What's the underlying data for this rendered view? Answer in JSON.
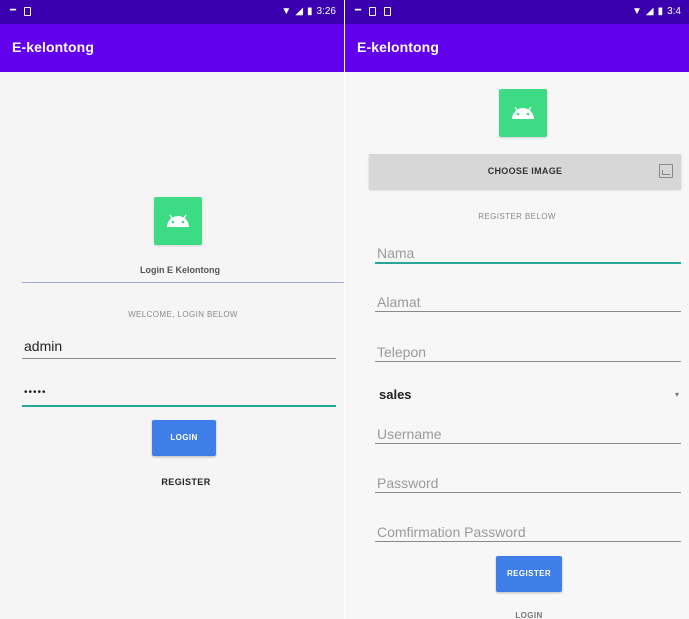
{
  "left": {
    "status": {
      "time": "3:26"
    },
    "app_title": "E-kelontong",
    "logo_caption": "Login E Kelontong",
    "welcome": "WELCOME, LOGIN BELOW",
    "username_value": "admin",
    "password_value": "•••••",
    "login_button": "LOGIN",
    "register_link": "REGISTER"
  },
  "right": {
    "status": {
      "time": "3:4"
    },
    "app_title": "E-kelontong",
    "choose_image": "CHOOSE IMAGE",
    "register_below": "REGISTER BELOW",
    "fields": {
      "nama": "Nama",
      "alamat": "Alamat",
      "telepon": "Telepon",
      "role_value": "sales",
      "username": "Username",
      "password": "Password",
      "confirm": "Comfirmation Password"
    },
    "register_button": "REGISTER",
    "login_link": "LOGIN"
  },
  "colors": {
    "statusbar": "#3a00b0",
    "appbar": "#6200ee",
    "accent": "#26a69a",
    "button": "#3f7ee8",
    "android_logo": "#3ddc84"
  },
  "icons": [
    "wifi-icon",
    "signal-icon",
    "battery-icon",
    "android-logo-icon",
    "image-icon",
    "dropdown-arrow-icon"
  ]
}
